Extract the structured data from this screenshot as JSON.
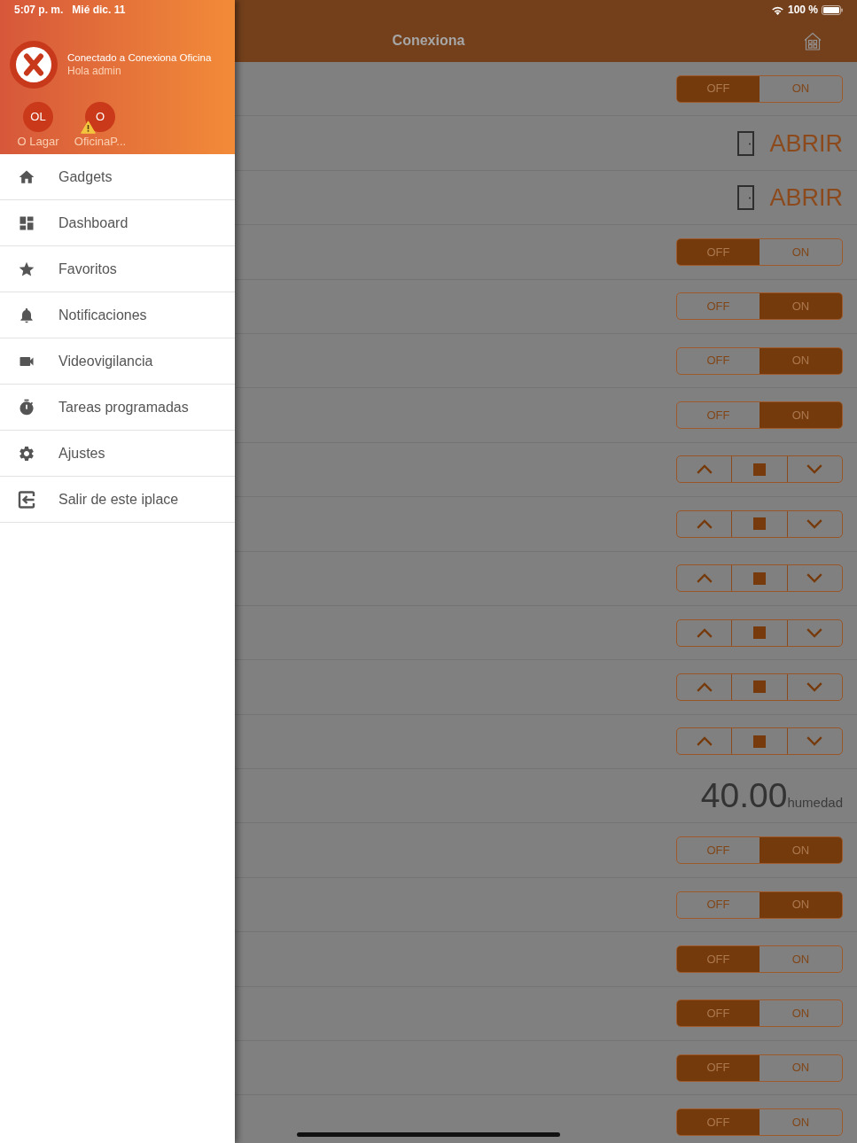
{
  "status_bar": {
    "time": "5:07 p. m.",
    "date": "Mié dic. 11",
    "battery": "100 %"
  },
  "drawer": {
    "connection": "Conectado a Conexiona Oficina",
    "greeting": "Hola admin",
    "sites": [
      {
        "initials": "OL",
        "name": "O Lagar",
        "warning": false
      },
      {
        "initials": "O",
        "name": "OficinaP...",
        "warning": true
      }
    ],
    "menu": [
      {
        "label": "Gadgets"
      },
      {
        "label": "Dashboard"
      },
      {
        "label": "Favoritos"
      },
      {
        "label": "Notificaciones"
      },
      {
        "label": "Videovigilancia"
      },
      {
        "label": "Tareas programadas"
      },
      {
        "label": "Ajustes"
      },
      {
        "label": "Salir de este iplace"
      }
    ]
  },
  "header": {
    "title": "Conexiona"
  },
  "gadgets": [
    {
      "kind": "toggle",
      "options": [
        {
          "label": "OFF",
          "selected": true
        },
        {
          "label": "ON",
          "selected": false
        }
      ]
    },
    {
      "kind": "door",
      "action": "ABRIR"
    },
    {
      "kind": "door",
      "action": "ABRIR"
    },
    {
      "kind": "toggle",
      "options": [
        {
          "label": "OFF",
          "selected": true
        },
        {
          "label": "ON",
          "selected": false
        }
      ]
    },
    {
      "kind": "toggle",
      "options": [
        {
          "label": "OFF",
          "selected": false
        },
        {
          "label": "ON",
          "selected": true
        }
      ]
    },
    {
      "kind": "toggle",
      "options": [
        {
          "label": "OFF",
          "selected": false
        },
        {
          "label": "ON",
          "selected": true
        }
      ]
    },
    {
      "kind": "toggle",
      "options": [
        {
          "label": "OFF",
          "selected": false
        },
        {
          "label": "ON",
          "selected": true
        }
      ]
    },
    {
      "kind": "blinds"
    },
    {
      "kind": "blinds"
    },
    {
      "kind": "blinds"
    },
    {
      "kind": "blinds"
    },
    {
      "kind": "blinds"
    },
    {
      "kind": "blinds"
    },
    {
      "kind": "value",
      "value": "40.00",
      "unit": "humedad"
    },
    {
      "kind": "toggle",
      "options": [
        {
          "label": "OFF",
          "selected": false
        },
        {
          "label": "ON",
          "selected": true
        }
      ]
    },
    {
      "kind": "toggle",
      "options": [
        {
          "label": "OFF",
          "selected": false
        },
        {
          "label": "ON",
          "selected": true
        }
      ]
    },
    {
      "kind": "toggle",
      "options": [
        {
          "label": "OFF",
          "selected": true
        },
        {
          "label": "ON",
          "selected": false
        }
      ]
    },
    {
      "kind": "toggle",
      "options": [
        {
          "label": "OFF",
          "selected": true
        },
        {
          "label": "ON",
          "selected": false
        }
      ]
    },
    {
      "kind": "toggle",
      "options": [
        {
          "label": "OFF",
          "selected": true
        },
        {
          "label": "ON",
          "selected": false
        }
      ]
    },
    {
      "kind": "toggle",
      "options": [
        {
          "label": "OFF",
          "selected": true
        },
        {
          "label": "ON",
          "selected": false
        }
      ]
    }
  ]
}
